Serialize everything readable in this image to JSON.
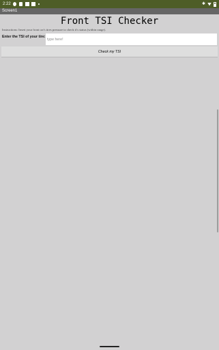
{
  "status_bar": {
    "time": "2:22",
    "bluetooth_icon": "bluetooth-icon",
    "wifi_icon": "wifi-icon",
    "battery_icon": "battery-icon"
  },
  "screen": {
    "name": "Screen1"
  },
  "app": {
    "title": "Front TSI Checker",
    "instructions": "Instructions: Insert your front car's tires pressure to check it's status (within range).",
    "input_label": "Enter the TSI of your tire:",
    "input_placeholder": "type here!",
    "input_value": "",
    "check_button_label": "Check my TSI"
  },
  "colors": {
    "status_bar_bg": "#4e5d27",
    "title_bar_bg": "#666666",
    "screen_bg": "#d2d1d2",
    "button_bg": "#dedede"
  }
}
